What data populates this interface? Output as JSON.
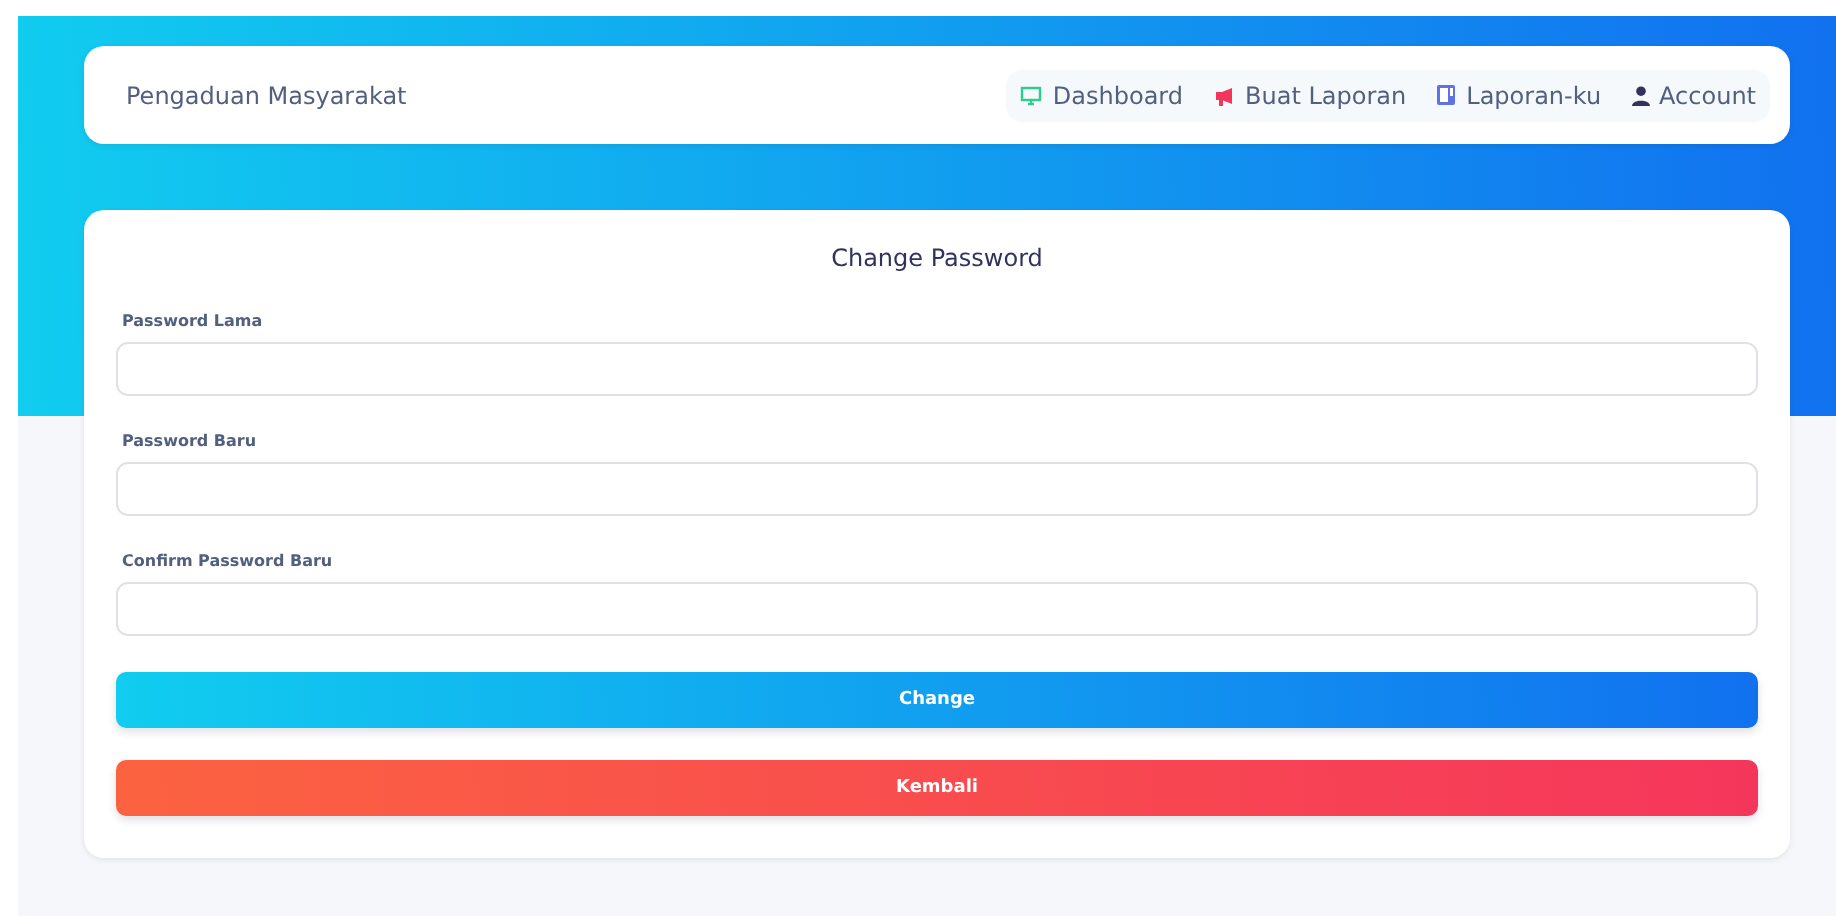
{
  "navbar": {
    "brand": "Pengaduan Masyarakat",
    "items": [
      {
        "label": "Dashboard"
      },
      {
        "label": "Buat Laporan"
      },
      {
        "label": "Laporan-ku"
      },
      {
        "label": "Account"
      }
    ]
  },
  "form": {
    "title": "Change Password",
    "fields": [
      {
        "label": "Password Lama"
      },
      {
        "label": "Password Baru"
      },
      {
        "label": "Confirm Password Baru"
      }
    ],
    "buttons": [
      {
        "label": "Change",
        "kind": "primary"
      },
      {
        "label": "Kembali",
        "kind": "danger"
      }
    ]
  }
}
